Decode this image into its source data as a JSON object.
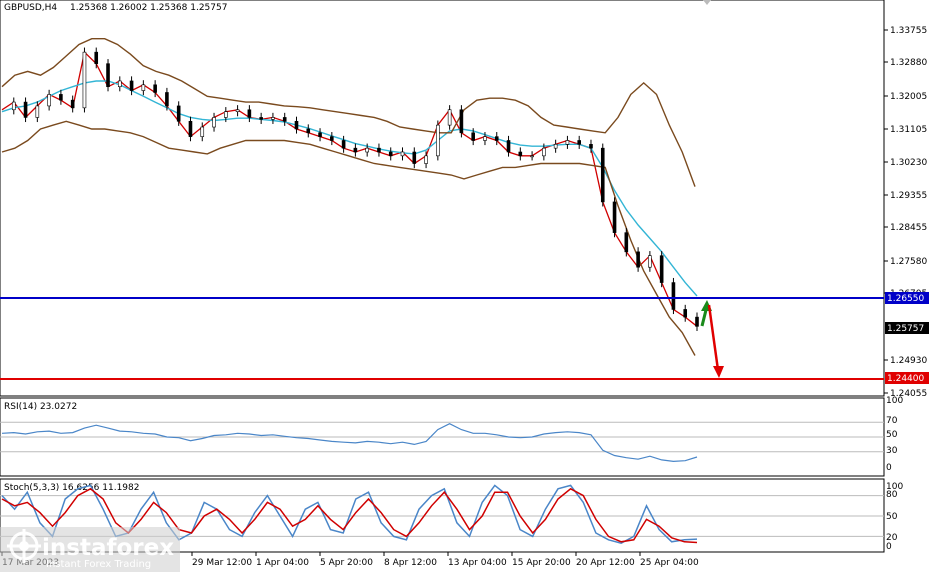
{
  "header": {
    "symbol_label": "GBPUSD,H4",
    "ohlc": "1.25368 1.26002 1.25368 1.25757"
  },
  "rsi_panel": {
    "label": "RSI(14) 23.0272",
    "levels": [
      "100",
      "70",
      "50",
      "30",
      "0"
    ]
  },
  "stoch_panel": {
    "label": "Stoch(5,3,3) 16.6256 11.1982",
    "levels": [
      "100",
      "80",
      "50",
      "20",
      "0"
    ]
  },
  "price_axis": {
    "ticks": [
      "1.33755",
      "1.32880",
      "1.32005",
      "1.31105",
      "1.30230",
      "1.29355",
      "1.28455",
      "1.27580",
      "1.26705",
      "1.25757",
      "1.24930",
      "1.24055"
    ]
  },
  "levels": {
    "resistance": {
      "value": "1.26550",
      "color": "#0000c8"
    },
    "support": {
      "value": "1.24400",
      "color": "#e00000"
    },
    "current": {
      "value": "1.25757"
    }
  },
  "time_axis": {
    "ticks": [
      "17 Mar 2023",
      "29 Mar 12:00",
      "1 Apr 04:00",
      "5 Apr 20:00",
      "8 Apr 12:00",
      "13 Apr 04:00",
      "15 Apr 20:00",
      "20 Apr 12:00",
      "25 Apr 04:00"
    ]
  },
  "watermark": {
    "brand": "instaforex",
    "tagline": "Instant Forex Trading"
  },
  "chart_data": {
    "type": "line",
    "title": "GBPUSD,H4",
    "ylim": [
      1.2405,
      1.3405
    ],
    "x_categories": [
      "17 Mar 2023",
      "29 Mar 12:00",
      "1 Apr 04:00",
      "5 Apr 20:00",
      "8 Apr 12:00",
      "13 Apr 04:00",
      "15 Apr 20:00",
      "20 Apr 12:00",
      "25 Apr 04:00"
    ],
    "series": [
      {
        "name": "close",
        "color": "#d00000",
        "values": [
          1.314,
          1.316,
          1.312,
          1.315,
          1.318,
          1.3165,
          1.3145,
          1.329,
          1.326,
          1.32,
          1.3215,
          1.319,
          1.3205,
          1.3185,
          1.315,
          1.311,
          1.307,
          1.3095,
          1.312,
          1.3135,
          1.314,
          1.312,
          1.3115,
          1.312,
          1.311,
          1.309,
          1.308,
          1.307,
          1.306,
          1.304,
          1.303,
          1.304,
          1.303,
          1.302,
          1.303,
          1.3,
          1.302,
          1.31,
          1.314,
          1.308,
          1.306,
          1.307,
          1.306,
          1.303,
          1.302,
          1.302,
          1.304,
          1.305,
          1.306,
          1.305,
          1.304,
          1.29,
          1.282,
          1.277,
          1.273,
          1.276,
          1.269,
          1.262,
          1.26,
          1.2576
        ]
      },
      {
        "name": "moving average",
        "color": "#33b5d5",
        "values": [
          1.3135,
          1.3145,
          1.315,
          1.316,
          1.3175,
          1.319,
          1.32,
          1.321,
          1.3215,
          1.3215,
          1.3205,
          1.319,
          1.3175,
          1.316,
          1.3145,
          1.313,
          1.312,
          1.3115,
          1.3112,
          1.3115,
          1.3118,
          1.3118,
          1.3115,
          1.3112,
          1.3108,
          1.31,
          1.3092,
          1.3082,
          1.3072,
          1.3062,
          1.3052,
          1.3045,
          1.3038,
          1.3032,
          1.3028,
          1.3025,
          1.3035,
          1.306,
          1.3085,
          1.309,
          1.3085,
          1.3075,
          1.3065,
          1.3055,
          1.3048,
          1.3045,
          1.3045,
          1.3048,
          1.305,
          1.305,
          1.304,
          1.299,
          1.293,
          1.288,
          1.284,
          1.2805,
          1.277,
          1.273,
          1.269,
          1.2655
        ]
      },
      {
        "name": "bollinger upper",
        "color": "#7a4a1e",
        "values": [
          1.32,
          1.323,
          1.324,
          1.323,
          1.325,
          1.328,
          1.331,
          1.3325,
          1.3325,
          1.331,
          1.3285,
          1.3255,
          1.324,
          1.323,
          1.3215,
          1.3195,
          1.3175,
          1.317,
          1.3165,
          1.316,
          1.316,
          1.3155,
          1.315,
          1.3148,
          1.3145,
          1.314,
          1.3135,
          1.313,
          1.3125,
          1.312,
          1.311,
          1.3095,
          1.309,
          1.3085,
          1.308,
          1.308,
          1.314,
          1.3165,
          1.317,
          1.317,
          1.3165,
          1.315,
          1.312,
          1.31,
          1.3095,
          1.309,
          1.3085,
          1.308,
          1.312,
          1.318,
          1.321,
          1.318,
          1.31,
          1.303,
          1.294
        ]
      },
      {
        "name": "bollinger lower",
        "color": "#7a4a1e",
        "values": [
          1.303,
          1.304,
          1.306,
          1.309,
          1.31,
          1.311,
          1.31,
          1.309,
          1.309,
          1.3085,
          1.308,
          1.307,
          1.3055,
          1.304,
          1.3035,
          1.303,
          1.3025,
          1.304,
          1.305,
          1.306,
          1.306,
          1.306,
          1.306,
          1.3055,
          1.305,
          1.304,
          1.303,
          1.302,
          1.301,
          1.3,
          1.2995,
          1.299,
          1.2985,
          1.298,
          1.2975,
          1.297,
          1.296,
          1.297,
          1.298,
          1.299,
          1.299,
          1.2995,
          1.3,
          1.3,
          1.3,
          1.3,
          1.2995,
          1.299,
          1.289,
          1.28,
          1.272,
          1.266,
          1.26,
          1.256,
          1.25
        ]
      }
    ],
    "rsi": {
      "name": "RSI(14)",
      "color": "#4a86c8",
      "ylim": [
        0,
        100
      ],
      "values": [
        55,
        56,
        54,
        57,
        58,
        55,
        56,
        62,
        66,
        62,
        58,
        57,
        55,
        54,
        50,
        49,
        45,
        48,
        52,
        53,
        55,
        54,
        52,
        53,
        51,
        49,
        48,
        46,
        44,
        43,
        42,
        44,
        43,
        41,
        43,
        40,
        44,
        60,
        68,
        60,
        55,
        55,
        53,
        50,
        49,
        50,
        54,
        56,
        57,
        56,
        53,
        32,
        25,
        22,
        20,
        24,
        19,
        17,
        18,
        23
      ]
    },
    "stoch": {
      "ylim": [
        0,
        100
      ],
      "series": [
        {
          "name": "%K",
          "color": "#4a86c8",
          "values": [
            80,
            60,
            85,
            40,
            20,
            75,
            90,
            95,
            60,
            20,
            25,
            60,
            85,
            40,
            15,
            25,
            70,
            60,
            30,
            20,
            55,
            80,
            50,
            20,
            60,
            70,
            30,
            25,
            75,
            85,
            40,
            20,
            15,
            60,
            80,
            90,
            40,
            20,
            70,
            95,
            80,
            30,
            20,
            60,
            90,
            95,
            70,
            25,
            15,
            10,
            20,
            65,
            30,
            12,
            15,
            16
          ]
        },
        {
          "name": "%D",
          "color": "#d00000",
          "values": [
            75,
            65,
            70,
            55,
            35,
            55,
            80,
            90,
            75,
            40,
            25,
            45,
            70,
            55,
            30,
            25,
            50,
            60,
            45,
            25,
            45,
            70,
            60,
            35,
            45,
            65,
            45,
            30,
            55,
            75,
            55,
            30,
            20,
            40,
            65,
            85,
            60,
            30,
            50,
            85,
            85,
            50,
            25,
            45,
            75,
            90,
            80,
            45,
            20,
            12,
            15,
            45,
            35,
            18,
            12,
            11
          ]
        }
      ]
    }
  }
}
